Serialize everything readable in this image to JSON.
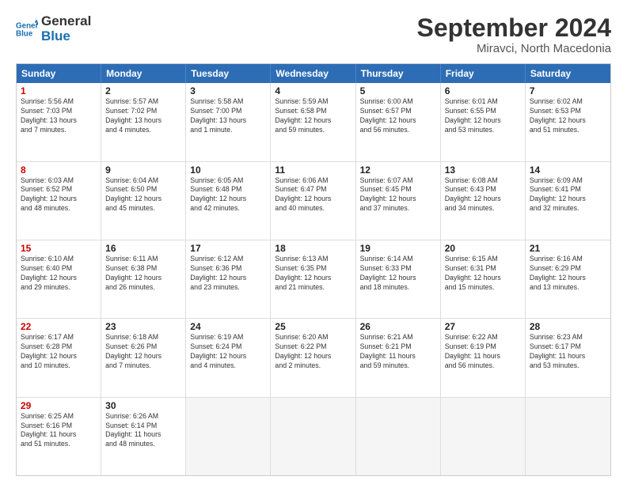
{
  "logo": {
    "line1": "General",
    "line2": "Blue"
  },
  "title": "September 2024",
  "location": "Miravci, North Macedonia",
  "days_of_week": [
    "Sunday",
    "Monday",
    "Tuesday",
    "Wednesday",
    "Thursday",
    "Friday",
    "Saturday"
  ],
  "weeks": [
    [
      {
        "day": "1",
        "info": "Sunrise: 5:56 AM\nSunset: 7:03 PM\nDaylight: 13 hours\nand 7 minutes.",
        "type": "sunday"
      },
      {
        "day": "2",
        "info": "Sunrise: 5:57 AM\nSunset: 7:02 PM\nDaylight: 13 hours\nand 4 minutes.",
        "type": ""
      },
      {
        "day": "3",
        "info": "Sunrise: 5:58 AM\nSunset: 7:00 PM\nDaylight: 13 hours\nand 1 minute.",
        "type": ""
      },
      {
        "day": "4",
        "info": "Sunrise: 5:59 AM\nSunset: 6:58 PM\nDaylight: 12 hours\nand 59 minutes.",
        "type": ""
      },
      {
        "day": "5",
        "info": "Sunrise: 6:00 AM\nSunset: 6:57 PM\nDaylight: 12 hours\nand 56 minutes.",
        "type": ""
      },
      {
        "day": "6",
        "info": "Sunrise: 6:01 AM\nSunset: 6:55 PM\nDaylight: 12 hours\nand 53 minutes.",
        "type": ""
      },
      {
        "day": "7",
        "info": "Sunrise: 6:02 AM\nSunset: 6:53 PM\nDaylight: 12 hours\nand 51 minutes.",
        "type": ""
      }
    ],
    [
      {
        "day": "8",
        "info": "Sunrise: 6:03 AM\nSunset: 6:52 PM\nDaylight: 12 hours\nand 48 minutes.",
        "type": "sunday"
      },
      {
        "day": "9",
        "info": "Sunrise: 6:04 AM\nSunset: 6:50 PM\nDaylight: 12 hours\nand 45 minutes.",
        "type": ""
      },
      {
        "day": "10",
        "info": "Sunrise: 6:05 AM\nSunset: 6:48 PM\nDaylight: 12 hours\nand 42 minutes.",
        "type": ""
      },
      {
        "day": "11",
        "info": "Sunrise: 6:06 AM\nSunset: 6:47 PM\nDaylight: 12 hours\nand 40 minutes.",
        "type": ""
      },
      {
        "day": "12",
        "info": "Sunrise: 6:07 AM\nSunset: 6:45 PM\nDaylight: 12 hours\nand 37 minutes.",
        "type": ""
      },
      {
        "day": "13",
        "info": "Sunrise: 6:08 AM\nSunset: 6:43 PM\nDaylight: 12 hours\nand 34 minutes.",
        "type": ""
      },
      {
        "day": "14",
        "info": "Sunrise: 6:09 AM\nSunset: 6:41 PM\nDaylight: 12 hours\nand 32 minutes.",
        "type": ""
      }
    ],
    [
      {
        "day": "15",
        "info": "Sunrise: 6:10 AM\nSunset: 6:40 PM\nDaylight: 12 hours\nand 29 minutes.",
        "type": "sunday"
      },
      {
        "day": "16",
        "info": "Sunrise: 6:11 AM\nSunset: 6:38 PM\nDaylight: 12 hours\nand 26 minutes.",
        "type": ""
      },
      {
        "day": "17",
        "info": "Sunrise: 6:12 AM\nSunset: 6:36 PM\nDaylight: 12 hours\nand 23 minutes.",
        "type": ""
      },
      {
        "day": "18",
        "info": "Sunrise: 6:13 AM\nSunset: 6:35 PM\nDaylight: 12 hours\nand 21 minutes.",
        "type": ""
      },
      {
        "day": "19",
        "info": "Sunrise: 6:14 AM\nSunset: 6:33 PM\nDaylight: 12 hours\nand 18 minutes.",
        "type": ""
      },
      {
        "day": "20",
        "info": "Sunrise: 6:15 AM\nSunset: 6:31 PM\nDaylight: 12 hours\nand 15 minutes.",
        "type": ""
      },
      {
        "day": "21",
        "info": "Sunrise: 6:16 AM\nSunset: 6:29 PM\nDaylight: 12 hours\nand 13 minutes.",
        "type": ""
      }
    ],
    [
      {
        "day": "22",
        "info": "Sunrise: 6:17 AM\nSunset: 6:28 PM\nDaylight: 12 hours\nand 10 minutes.",
        "type": "sunday"
      },
      {
        "day": "23",
        "info": "Sunrise: 6:18 AM\nSunset: 6:26 PM\nDaylight: 12 hours\nand 7 minutes.",
        "type": ""
      },
      {
        "day": "24",
        "info": "Sunrise: 6:19 AM\nSunset: 6:24 PM\nDaylight: 12 hours\nand 4 minutes.",
        "type": ""
      },
      {
        "day": "25",
        "info": "Sunrise: 6:20 AM\nSunset: 6:22 PM\nDaylight: 12 hours\nand 2 minutes.",
        "type": ""
      },
      {
        "day": "26",
        "info": "Sunrise: 6:21 AM\nSunset: 6:21 PM\nDaylight: 11 hours\nand 59 minutes.",
        "type": ""
      },
      {
        "day": "27",
        "info": "Sunrise: 6:22 AM\nSunset: 6:19 PM\nDaylight: 11 hours\nand 56 minutes.",
        "type": ""
      },
      {
        "day": "28",
        "info": "Sunrise: 6:23 AM\nSunset: 6:17 PM\nDaylight: 11 hours\nand 53 minutes.",
        "type": ""
      }
    ],
    [
      {
        "day": "29",
        "info": "Sunrise: 6:25 AM\nSunset: 6:16 PM\nDaylight: 11 hours\nand 51 minutes.",
        "type": "sunday"
      },
      {
        "day": "30",
        "info": "Sunrise: 6:26 AM\nSunset: 6:14 PM\nDaylight: 11 hours\nand 48 minutes.",
        "type": ""
      },
      {
        "day": "",
        "info": "",
        "type": "empty"
      },
      {
        "day": "",
        "info": "",
        "type": "empty"
      },
      {
        "day": "",
        "info": "",
        "type": "empty"
      },
      {
        "day": "",
        "info": "",
        "type": "empty"
      },
      {
        "day": "",
        "info": "",
        "type": "empty"
      }
    ]
  ]
}
